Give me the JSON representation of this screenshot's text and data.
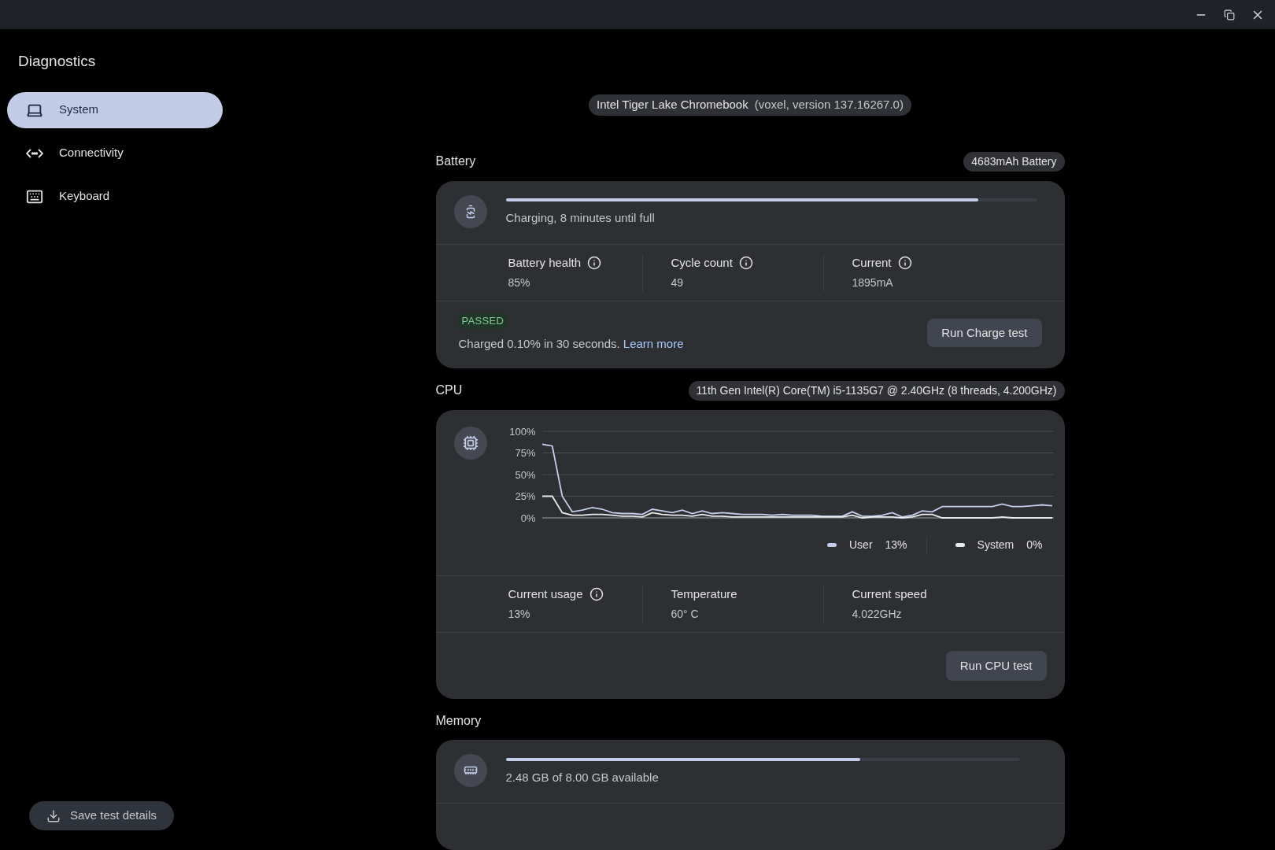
{
  "sidebar": {
    "title": "Diagnostics",
    "items": [
      {
        "label": "System",
        "selected": true
      },
      {
        "label": "Connectivity",
        "selected": false
      },
      {
        "label": "Keyboard",
        "selected": false
      }
    ],
    "save_button": "Save test details"
  },
  "device": {
    "name": "Intel Tiger Lake Chromebook",
    "version": "(voxel, version 137.16267.0)"
  },
  "battery": {
    "title": "Battery",
    "badge": "4683mAh Battery",
    "level": 0.89,
    "status": "Charging, 8 minutes until full",
    "stats": [
      {
        "label": "Battery health",
        "value": "85%",
        "info": true
      },
      {
        "label": "Cycle count",
        "value": "49",
        "info": true
      },
      {
        "label": "Current",
        "value": "1895mA",
        "info": true
      }
    ],
    "result": {
      "status": "PASSED",
      "color": "#81c995",
      "message": "Charged 0.10% in 30 seconds.",
      "link": "Learn more"
    },
    "button": "Run Charge test"
  },
  "cpu": {
    "title": "CPU",
    "badge": "11th Gen Intel(R) Core(TM) i5-1135G7 @ 2.40GHz (8 threads, 4.200GHz)",
    "chart_data": {
      "type": "line",
      "grid": true,
      "ylim": [
        0,
        100
      ],
      "yticks": [
        {
          "value": 0,
          "label": "0%"
        },
        {
          "value": 25,
          "label": "25%"
        },
        {
          "value": 50,
          "label": "50%"
        },
        {
          "value": 75,
          "label": "75%"
        },
        {
          "value": 100,
          "label": "100%"
        }
      ],
      "series": [
        {
          "name": "User",
          "color": "#c4cdea",
          "values": [
            85,
            83,
            25,
            7,
            9,
            12,
            10,
            6,
            5,
            5,
            4,
            10,
            8,
            6,
            9,
            5,
            8,
            5,
            6,
            5,
            4,
            4,
            4,
            3,
            4,
            3,
            3,
            3,
            2,
            2,
            2,
            7,
            2,
            2,
            3,
            6,
            1,
            3,
            8,
            7,
            13,
            13,
            13,
            13,
            13,
            13,
            16,
            13,
            13,
            14,
            15,
            14
          ]
        },
        {
          "name": "System",
          "color": "#e8eaed",
          "values": [
            25,
            25,
            6,
            3,
            3,
            4,
            4,
            3,
            2,
            2,
            1,
            6,
            4,
            3,
            3,
            2,
            4,
            2,
            2,
            1,
            1,
            1,
            1,
            1,
            1,
            1,
            1,
            1,
            1,
            1,
            1,
            3,
            0,
            1,
            1,
            1,
            0,
            1,
            4,
            4,
            0,
            0,
            0,
            0,
            0,
            0,
            1,
            0,
            0,
            0,
            0,
            0
          ]
        }
      ]
    },
    "legend": [
      {
        "value": "13%"
      },
      {
        "value": "0%"
      }
    ],
    "stats": [
      {
        "label": "Current usage",
        "value": "13%",
        "info": true
      },
      {
        "label": "Temperature",
        "value": "60° C",
        "info": false
      },
      {
        "label": "Current speed",
        "value": "4.022GHz",
        "info": false
      }
    ],
    "button": "Run CPU test"
  },
  "memory": {
    "title": "Memory",
    "level": 0.69,
    "status": "2.48 GB of 8.00 GB available"
  }
}
